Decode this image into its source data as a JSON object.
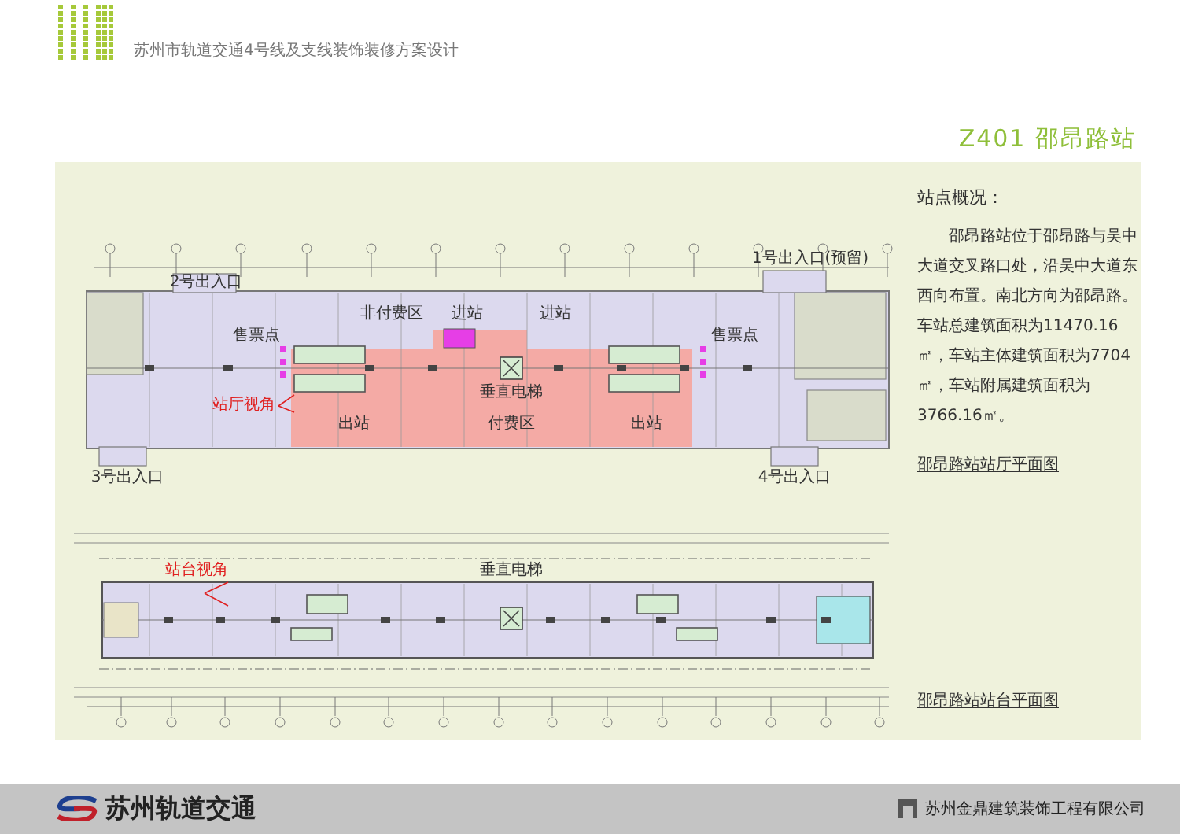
{
  "header": {
    "title": "苏州市轨道交通4号线及支线装饰装修方案设计"
  },
  "station_title": "Z401 邵昂路站",
  "overview": {
    "heading": "站点概况：",
    "text": "邵昂路站位于邵昂路与吴中大道交叉路口处，沿吴中大道东西向布置。南北方向为邵昂路。车站总建筑面积为11470.16㎡，车站主体建筑面积为7704㎡，车站附属建筑面积为3766.16㎡。"
  },
  "concourse_plan": {
    "caption": "邵昂路站站厅平面图",
    "labels": [
      {
        "text": "2号出入口",
        "kind": "area"
      },
      {
        "text": "1号出入口(预留)",
        "kind": "area"
      },
      {
        "text": "非付费区",
        "kind": "area"
      },
      {
        "text": "进站",
        "kind": "area"
      },
      {
        "text": "进站",
        "kind": "area"
      },
      {
        "text": "售票点",
        "kind": "area"
      },
      {
        "text": "售票点",
        "kind": "area"
      },
      {
        "text": "垂直电梯",
        "kind": "area"
      },
      {
        "text": "站厅视角",
        "kind": "viewpoint"
      },
      {
        "text": "出站",
        "kind": "area"
      },
      {
        "text": "付费区",
        "kind": "area"
      },
      {
        "text": "出站",
        "kind": "area"
      },
      {
        "text": "3号出入口",
        "kind": "area"
      },
      {
        "text": "4号出入口",
        "kind": "area"
      }
    ]
  },
  "platform_plan": {
    "caption": "邵昂路站站台平面图",
    "labels": [
      {
        "text": "站台视角",
        "kind": "viewpoint"
      },
      {
        "text": "垂直电梯",
        "kind": "area"
      }
    ]
  },
  "footer": {
    "logo_text": "苏州轨道交通",
    "company": "苏州金鼎建筑装饰工程有限公司"
  }
}
